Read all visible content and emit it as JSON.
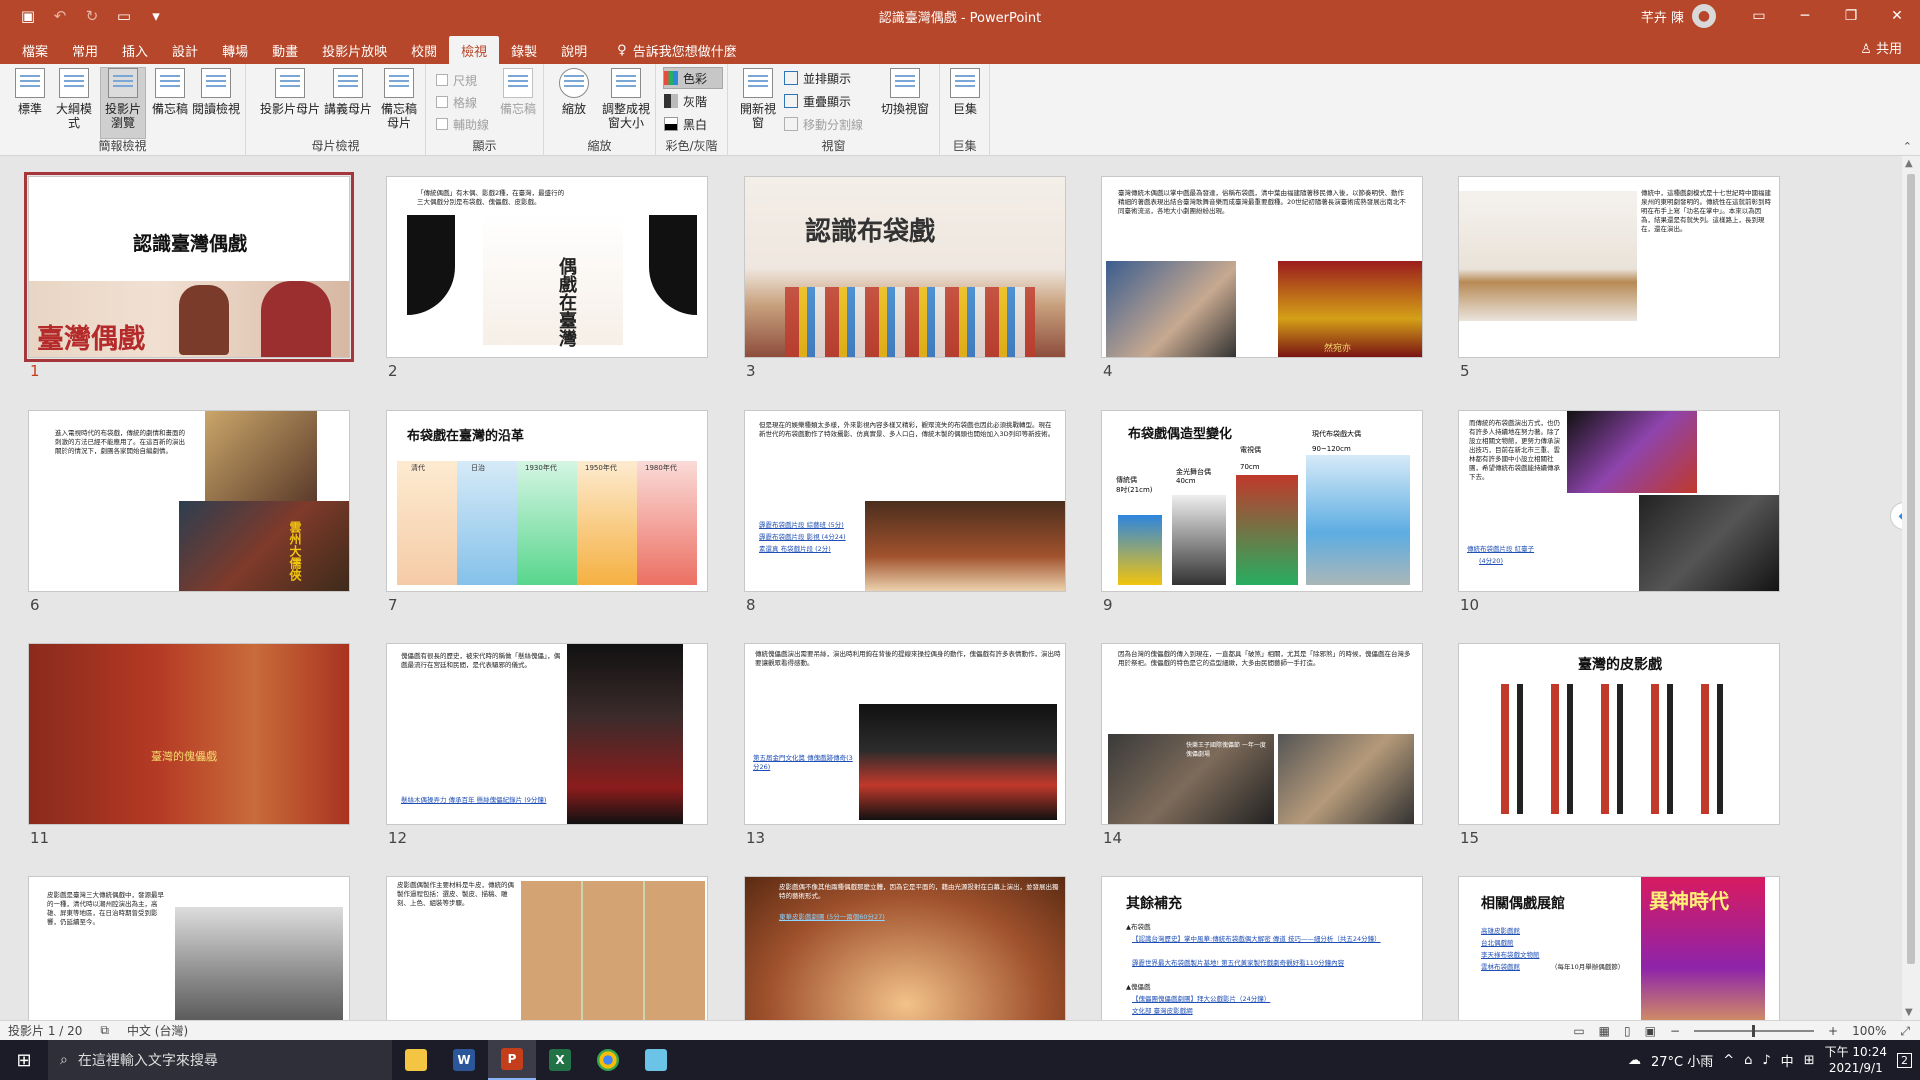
{
  "window": {
    "title": "認識臺灣偶戲 - PowerPoint",
    "user": "芊卉 陳"
  },
  "ribbon_tabs": [
    "檔案",
    "常用",
    "插入",
    "設計",
    "轉場",
    "動畫",
    "投影片放映",
    "校閱",
    "檢視",
    "錄製",
    "說明"
  ],
  "tell_me": "告訴我您想做什麼",
  "share": "共用",
  "ribbon": {
    "presentation_views": {
      "label": "簡報檢視",
      "buttons": [
        "標準",
        "大綱模式",
        "投影片瀏覽",
        "備忘稿",
        "閱讀檢視"
      ]
    },
    "master_views": {
      "label": "母片檢視",
      "buttons": [
        "投影片母片",
        "講義母片",
        "備忘稿母片"
      ]
    },
    "show": {
      "label": "顯示",
      "checks": [
        "尺規",
        "格線",
        "輔助線"
      ],
      "notes": "備忘稿"
    },
    "zoom": {
      "label": "縮放",
      "buttons": [
        "縮放",
        "調整成視窗大小"
      ]
    },
    "color": {
      "label": "彩色/灰階",
      "options": [
        "色彩",
        "灰階",
        "黑白"
      ]
    },
    "window": {
      "label": "視窗",
      "new_window": "開新視窗",
      "small": [
        "並排顯示",
        "重疊顯示",
        "移動分割線"
      ],
      "switch": "切換視窗"
    },
    "macros": {
      "label": "巨集",
      "button": "巨集"
    }
  },
  "slides": [
    {
      "num": "1",
      "title": "認識臺灣偶戲",
      "caption": "臺灣偶戲"
    },
    {
      "num": "2",
      "text": "「傳統偶戲」有木偶、影戲2種，在臺灣，最盛行的三大偶戲分別是布袋戲、傀儡戲、皮影戲。",
      "caption": "偶戲在臺灣"
    },
    {
      "num": "3",
      "caption": "認識布袋戲"
    },
    {
      "num": "4",
      "text": "臺灣傳統木偶戲以掌中戲最為發達，俗稱布袋戲，清中葉由福建隨著移民傳入後，以節奏明快、動作精細的著戲表現出結合臺灣歌舞音樂而成臺灣最重要戲種。20世紀初隨著長演臺術成熟發展出南北不同臺術流派，各地大小劇團紛紛出現。",
      "caption": "然宛亦"
    },
    {
      "num": "5",
      "text": "傳統中，這種戲劇模式是十七世紀時中國福建泉州的東明劇發明的。傳統性在這就前彰到時明在布手上寫「功名在掌中」。本來以為因為，結果還是有就失列。這樣路上，長到現在，還在演出。"
    },
    {
      "num": "6",
      "text": "進入電視時代的布袋戲，傳統的劇情和畫面的刺激的方法已經不能應用了。在這百新的演出關於的情況下，劇團各家開始自編劇情。",
      "caption": "雲州大儒俠"
    },
    {
      "num": "7",
      "title": "布袋戲在臺灣的沿革",
      "eras": [
        "清代",
        "日治",
        "1930年代",
        "1950年代",
        "1980年代"
      ]
    },
    {
      "num": "8",
      "text": "但是現在的娛樂種類太多樣，外來影視內容多樣又精彩，觀眾流失的布袋戲也因此必須挑戰轉型。現在新世代的布袋戲動作了特效攝影、仿真實景、多人口白，傳統木製的偶頭也開始加入3D列印等新技術。",
      "links": [
        "霹靂布袋戲片段 綜藝班 (5分)",
        "霹靂布袋戲片段 影視 (4分24)",
        "素還真 布袋戲片段 (2分)"
      ]
    },
    {
      "num": "9",
      "title": "布袋戲偶造型變化",
      "labels": [
        "傳統偶",
        "8吋(21cm)",
        "金光舞台偶",
        "40cm",
        "電視偶",
        "70cm",
        "現代布袋戲大偶",
        "90~120cm"
      ]
    },
    {
      "num": "10",
      "text": "而傳統的布袋戲演出方式，也仍有許多人持續地在努力著。除了設立相關文物館，更努力傳承演出技巧，目前在新北市三重、雲林都有許多國中小設立相關社團，希望傳統布袋戲能持續傳承下去。",
      "links": [
        "傳統布袋戲片段 紅臺子",
        "(4分20)"
      ]
    },
    {
      "num": "11",
      "caption": "臺灣的傀儡戲"
    },
    {
      "num": "12",
      "text": "傀儡戲有很長的歷史，被宋代時的稱做「懸絲傀儡」，偶戲最流行在宮廷和民間，是代表驅邪的儀式。",
      "links": [
        "懸絲木偶操弄力 傳承百年 懸絲傀儡紀錄片 (9分鐘)"
      ]
    },
    {
      "num": "13",
      "text": "傳統傀儡戲演出需要吊絲，演出時利用鉤在背後的提線來操控偶身的動作，傀儡戲有許多表情動作，演出時要讓觀眾看得感動。",
      "links": [
        "第五屆金門文化獎 傳傀戲跡傳奇(3分26)"
      ]
    },
    {
      "num": "14",
      "text": "因為台灣的傀儡戲的傳入到現在，一直都具「破煞」相關，尤其是「除邪煞」的時候，傀儡戲在台灣多用於祭祀。傀儡戲的特色是它的造型細緻，大多由民間藝師一手打造。",
      "caption": "快樂王子國際傀儡節 一年一度傀儡劇場"
    },
    {
      "num": "15",
      "title": "臺灣的皮影戲"
    },
    {
      "num": "16",
      "text": "皮影戲是臺灣三大傳統偶戲中，發源最早的一種，清代時以潮州腔演出為主，高雄、屏東等地區，在日治時期曾受到影響，仍延續至今。"
    },
    {
      "num": "17",
      "text": "皮影戲偶製作主要材料是牛皮，傳統的偶製作過程包括：選皮、製皮、描稿、雕刻、上色、組裝等步驟。"
    },
    {
      "num": "18",
      "text": "皮影戲偶不像其他兩種偶戲那麼立體，因為它是平面的，藉由光源投射在白幕上演出，並發展出獨特的藝術形式。",
      "links": [
        "東華皮影戲劇團 (5分一兩個60分27)"
      ]
    },
    {
      "num": "19",
      "title": "其餘補充",
      "bullets": [
        "▲布袋戲",
        "▲傀儡戲",
        "▲皮影戲"
      ],
      "links": [
        "【認識台灣歷史】掌中風華:傳統布袋戲偶大解密 傳道 技巧——細分析（共五24分鐘）",
        "霹靂世界最大布袋戲製片基地! 第五代黃家製作戲劇奇觀好看110分鐘內容",
        "【傀儡團傀儡戲劇團】拜大公戲影片（24分鐘）",
        "文化部 臺灣皮影戲網"
      ]
    },
    {
      "num": "20",
      "title": "相關偶戲展館",
      "links": [
        "高雄皮影戲館",
        "台北偶戲館",
        "李天祿布袋戲文物館",
        "雲林布袋戲館"
      ],
      "note": "（每年10月舉辦偶戲節）",
      "poster": "異神時代"
    }
  ],
  "status": {
    "slide": "投影片 1 / 20",
    "language": "中文 (台灣)",
    "zoom": "100%"
  },
  "taskbar": {
    "search_placeholder": "在這裡輸入文字來搜尋",
    "weather": "27°C 小雨",
    "ime": "中",
    "time": "下午 10:24",
    "date": "2021/9/1",
    "notify": "2"
  },
  "colors": {
    "accent": "#b7472a",
    "selection": "#a5373b",
    "link": "#1f4fb5"
  }
}
